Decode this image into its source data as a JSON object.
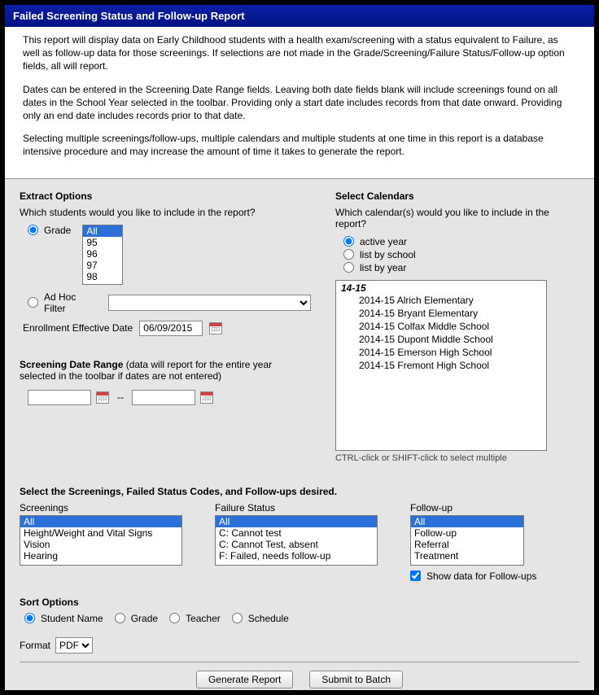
{
  "title": "Failed Screening Status and Follow-up Report",
  "intro": {
    "p1": "This report will display data on Early Childhood students with a health exam/screening with a status equivalent to Failure, as well as follow-up data for those screenings. If selections are not made in the Grade/Screening/Failure Status/Follow-up option fields, all will report.",
    "p2": "Dates can be entered in the Screening Date Range fields. Leaving both date fields blank will include screenings found on all dates in the School Year selected in the toolbar. Providing only a start date includes records from that date onward. Providing only an end date includes records prior to that date.",
    "p3": "Selecting multiple screenings/follow-ups, multiple calendars and multiple students at one time in this report is a database intensive procedure and may increase the amount of time it takes to generate the report."
  },
  "extract": {
    "heading": "Extract Options",
    "question": "Which students would you like to include in the report?",
    "grade_label": "Grade",
    "grade_options": [
      "All",
      "95",
      "96",
      "97",
      "98"
    ],
    "adhoc_label": "Ad Hoc Filter",
    "enroll_label": "Enrollment Effective Date",
    "enroll_value": "06/09/2015"
  },
  "calendars": {
    "heading": "Select Calendars",
    "question": "Which calendar(s) would you like to include in the report?",
    "opt_active": "active year",
    "opt_school": "list by school",
    "opt_year": "list by year",
    "year_label": "14-15",
    "schools": [
      "2014-15 Alrich Elementary",
      "2014-15 Bryant Elementary",
      "2014-15 Colfax Middle School",
      "2014-15 Dupont Middle School",
      "2014-15 Emerson High School",
      "2014-15 Fremont High School"
    ],
    "hint": "CTRL-click or SHIFT-click to select multiple"
  },
  "daterange": {
    "label_strong": "Screening Date Range",
    "label_rest": " (data will report for the entire year selected in the toolbar if dates are not entered)"
  },
  "screenings_section": {
    "heading": "Select the Screenings, Failed Status Codes, and Follow-ups desired.",
    "screenings_label": "Screenings",
    "screenings": [
      "All",
      "Height/Weight and Vital Signs",
      "Vision",
      "Hearing"
    ],
    "failure_label": "Failure Status",
    "failure": [
      "All",
      "C: Cannot test",
      "C: Cannot Test, absent",
      "F: Failed, needs follow-up"
    ],
    "followup_label": "Follow-up",
    "followup": [
      "All",
      "Follow-up",
      "Referral",
      "Treatment"
    ],
    "show_data_label": "Show data for Follow-ups"
  },
  "sort": {
    "heading": "Sort Options",
    "student": "Student Name",
    "grade": "Grade",
    "teacher": "Teacher",
    "schedule": "Schedule"
  },
  "format": {
    "label": "Format",
    "value": "PDF"
  },
  "actions": {
    "generate": "Generate Report",
    "submit": "Submit to Batch"
  }
}
